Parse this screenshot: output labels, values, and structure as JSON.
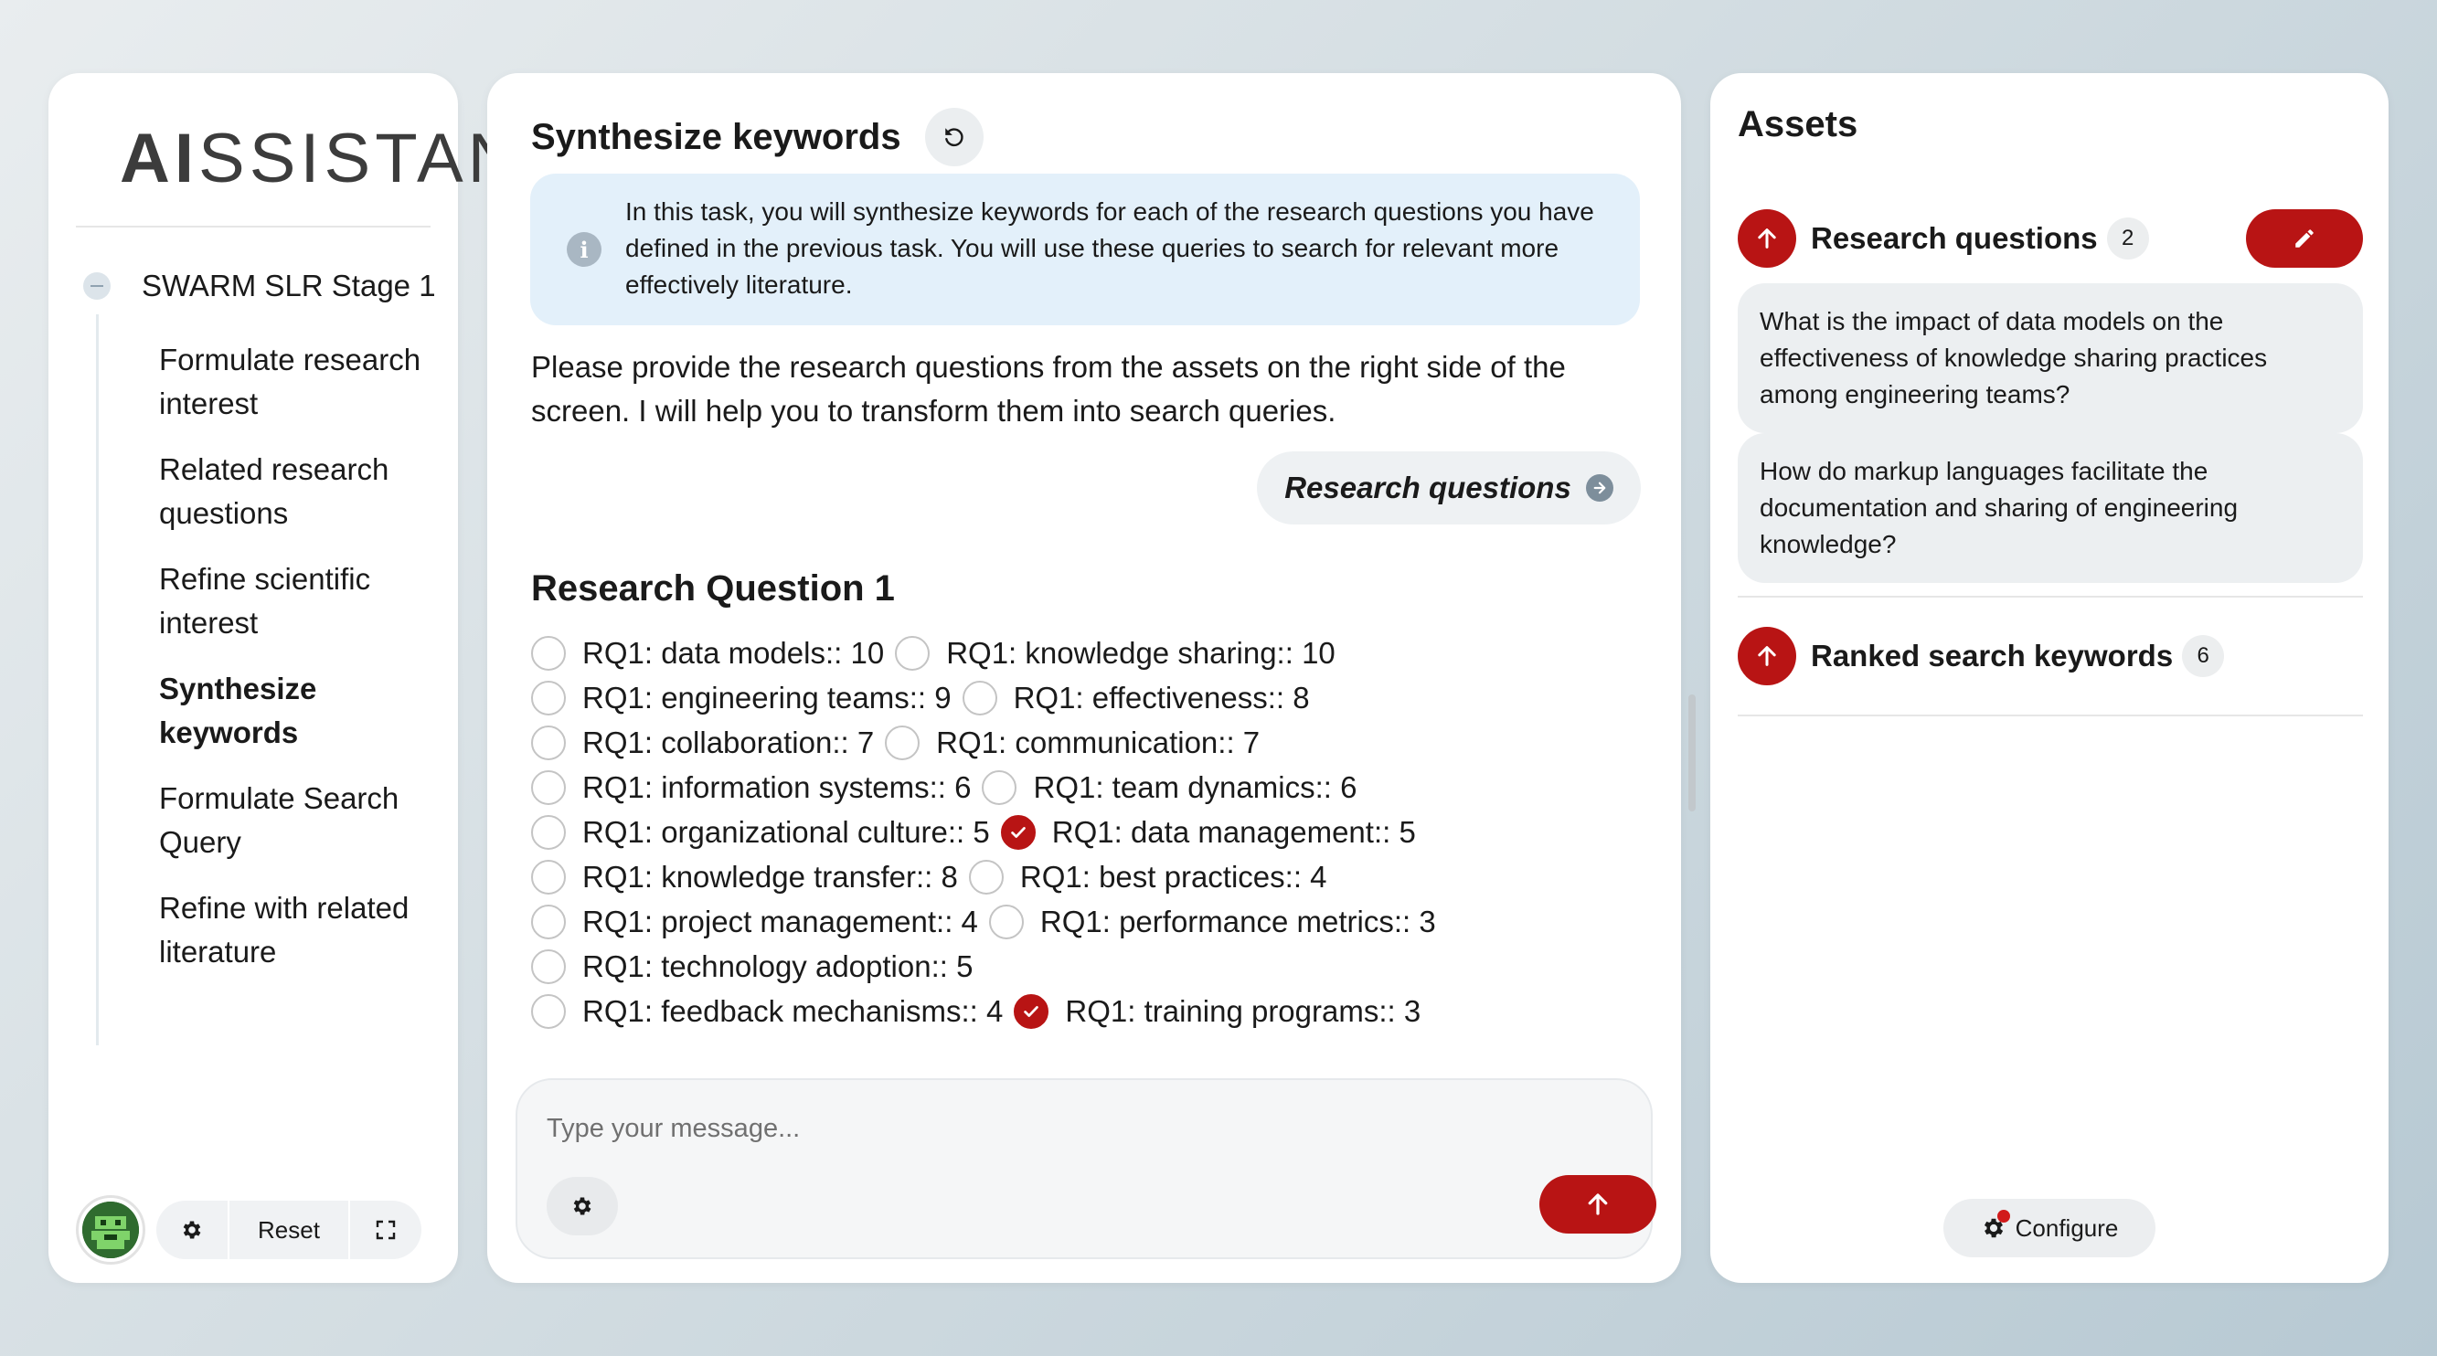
{
  "sidebar": {
    "logo_bold": "AI",
    "logo_rest": "SSISTANT",
    "stage_label": "SWARM SLR Stage 1",
    "items": [
      {
        "label": "Formulate research interest",
        "active": false
      },
      {
        "label": "Related research questions",
        "active": false
      },
      {
        "label": "Refine scientific interest",
        "active": false
      },
      {
        "label": "Synthesize keywords",
        "active": true
      },
      {
        "label": "Formulate Search Query",
        "active": false
      },
      {
        "label": "Refine with related literature",
        "active": false
      }
    ],
    "footer": {
      "reset_label": "Reset",
      "avatar_icon": "pixel-robot-avatar",
      "settings_icon": "gear-icon",
      "fullscreen_icon": "expand-icon"
    }
  },
  "main": {
    "title": "Synthesize keywords",
    "info_text": "In this task, you will synthesize keywords for each of the research questions you have defined in the previous task. You will use these queries to search for relevant more effectively literature.",
    "prompt": "Please provide the research questions from the assets on the right side of the screen. I will help you to transform them into search queries.",
    "rq_chip_label": "Research questions",
    "section_heading": "Research Question 1",
    "keyword_rows": [
      [
        {
          "label": "RQ1: data models:: 10",
          "checked": false
        },
        {
          "label": "RQ1: knowledge sharing:: 10",
          "checked": false
        }
      ],
      [
        {
          "label": "RQ1: engineering teams:: 9",
          "checked": false
        },
        {
          "label": "RQ1: effectiveness:: 8",
          "checked": false
        }
      ],
      [
        {
          "label": "RQ1: collaboration:: 7",
          "checked": false
        },
        {
          "label": "RQ1: communication:: 7",
          "checked": false
        }
      ],
      [
        {
          "label": "RQ1: information systems:: 6",
          "checked": false
        },
        {
          "label": "RQ1: team dynamics:: 6",
          "checked": false
        }
      ],
      [
        {
          "label": "RQ1: organizational culture:: 5",
          "checked": false
        },
        {
          "label": "RQ1: data management:: 5",
          "checked": true
        }
      ],
      [
        {
          "label": "RQ1: knowledge transfer:: 8",
          "checked": false
        },
        {
          "label": "RQ1: best practices:: 4",
          "checked": false
        }
      ],
      [
        {
          "label": "RQ1: project management:: 4",
          "checked": false
        },
        {
          "label": "RQ1: performance metrics:: 3",
          "checked": false
        }
      ],
      [
        {
          "label": "RQ1: technology adoption:: 5",
          "checked": false
        }
      ],
      [
        {
          "label": "RQ1: feedback mechanisms:: 4",
          "checked": false
        },
        {
          "label": "RQ1: training programs:: 3",
          "checked": true
        }
      ]
    ],
    "composer": {
      "placeholder": "Type your message...",
      "settings_icon": "gear-icon",
      "send_icon": "arrow-up-icon"
    }
  },
  "assets": {
    "title": "Assets",
    "research_questions": {
      "label": "Research questions",
      "count": "2",
      "items": [
        " What is the impact of data models on the effectiveness of knowledge sharing practices among engineering teams?",
        " How do markup languages facilitate the documentation and sharing of engineering knowledge?"
      ]
    },
    "ranked_keywords": {
      "label": "Ranked search keywords",
      "count": "6"
    },
    "configure_label": "Configure"
  },
  "colors": {
    "accent": "#b81414",
    "info_bg": "#e3f0fa",
    "chip_bg": "#eef1f3"
  }
}
